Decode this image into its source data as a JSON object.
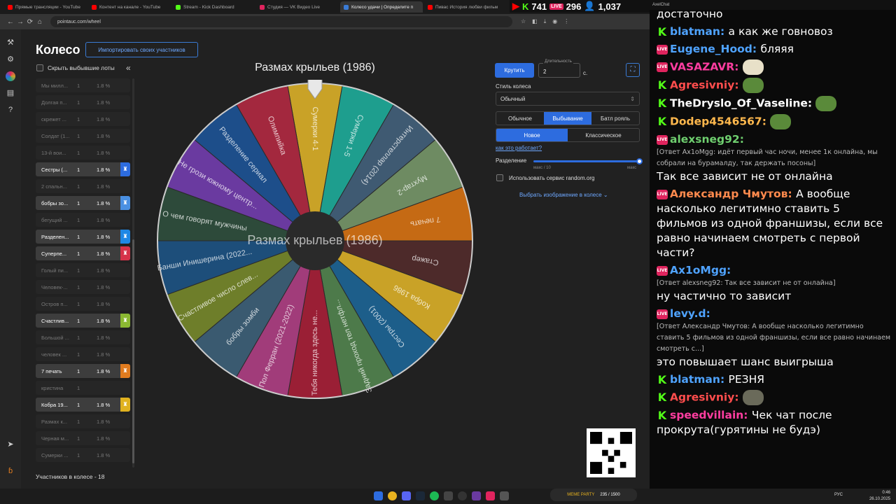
{
  "browser": {
    "tabs": [
      {
        "label": "Прямые трансляции - YouTube",
        "color": "#ff0000"
      },
      {
        "label": "Контент на канале - YouTube",
        "color": "#ff0000"
      },
      {
        "label": "Stream - Kick Dashboard",
        "color": "#53fc18"
      },
      {
        "label": "Студия — VK Видео Live",
        "color": "#e0245e"
      },
      {
        "label": "Колесо удачи | Определите п",
        "color": "#3a7bd5"
      },
      {
        "label": "Пивас История любви фильм",
        "color": "#ff0000"
      }
    ],
    "url": "pointauc.com/wheel"
  },
  "ticker": {
    "kick": "741",
    "vk": "296",
    "viewers": "1,037"
  },
  "page": {
    "title": "Колесо",
    "import_label": "Импортировать своих участников",
    "hide_label": "Скрыть выбывшие лоты",
    "count_label": "Участников в колесе - 18",
    "wheel_title": "Размах крыльев (1986)",
    "center_label": "Размах крыльев (1986)"
  },
  "lots": [
    {
      "name": "Мы милл...",
      "qty": "1",
      "pct": "1.8 %",
      "active": false
    },
    {
      "name": "Долгая п...",
      "qty": "1",
      "pct": "1.8 %",
      "active": false
    },
    {
      "name": "скрежет ...",
      "qty": "1",
      "pct": "1.8 %",
      "active": false
    },
    {
      "name": "Солдат (1...",
      "qty": "1",
      "pct": "1.8 %",
      "active": false
    },
    {
      "name": "13-й вои...",
      "qty": "1",
      "pct": "1.8 %",
      "active": false
    },
    {
      "name": "Сестры (...",
      "qty": "1",
      "pct": "1.8 %",
      "active": true,
      "color": "#2d6cdf"
    },
    {
      "name": "2 спальн...",
      "qty": "1",
      "pct": "1.8 %",
      "active": false
    },
    {
      "name": "бобры зо...",
      "qty": "1",
      "pct": "1.8 %",
      "active": true,
      "color": "#4a90e2"
    },
    {
      "name": "бегущий ...",
      "qty": "1",
      "pct": "1.8 %",
      "active": false
    },
    {
      "name": "Разделен...",
      "qty": "1",
      "pct": "1.8 %",
      "active": true,
      "color": "#1e88e5"
    },
    {
      "name": "Суперпе...",
      "qty": "1",
      "pct": "1.8 %",
      "active": true,
      "color": "#d6334a"
    },
    {
      "name": "Голый пи...",
      "qty": "1",
      "pct": "1.8 %",
      "active": false
    },
    {
      "name": "Человек-...",
      "qty": "1",
      "pct": "1.8 %",
      "active": false
    },
    {
      "name": "Остров п...",
      "qty": "1",
      "pct": "1.8 %",
      "active": false
    },
    {
      "name": "Счастлив...",
      "qty": "1",
      "pct": "1.8 %",
      "active": true,
      "color": "#8bb832"
    },
    {
      "name": "Большой ...",
      "qty": "1",
      "pct": "1.8 %",
      "active": false
    },
    {
      "name": "человек ...",
      "qty": "1",
      "pct": "1.8 %",
      "active": false
    },
    {
      "name": "7 печать",
      "qty": "1",
      "pct": "1.8 %",
      "active": true,
      "color": "#e07b1f"
    },
    {
      "name": "кристина",
      "qty": "1",
      "pct": "",
      "active": false
    },
    {
      "name": "Кобра 19...",
      "qty": "1",
      "pct": "1.8 %",
      "active": true,
      "color": "#e0b21f"
    },
    {
      "name": "Размах к...",
      "qty": "1",
      "pct": "1.8 %",
      "active": false
    },
    {
      "name": "Черная м...",
      "qty": "1",
      "pct": "1.8 %",
      "active": false
    },
    {
      "name": "Сумерки ...",
      "qty": "1",
      "pct": "1.8 %",
      "active": false
    }
  ],
  "wheel_segments": [
    {
      "label": "Сумерки 4-1",
      "color": "#c9a227"
    },
    {
      "label": "Сумерки 1-5",
      "color": "#1e9e8e"
    },
    {
      "label": "Интерстеллар (2014)",
      "color": "#3f5a72"
    },
    {
      "label": "Мухтар-2",
      "color": "#6e8b62"
    },
    {
      "label": "7 печать",
      "color": "#c56a14"
    },
    {
      "label": "Стажер",
      "color": "#4d2a2a"
    },
    {
      "label": "Кобра 1986",
      "color": "#c9a227"
    },
    {
      "label": "Сестры (2001)",
      "color": "#1d5e8a"
    },
    {
      "label": "Задний проход тел нетфл...",
      "color": "#4d7a4a"
    },
    {
      "label": "Тебя никогда здесь не...",
      "color": "#9a1f35"
    },
    {
      "label": "Пол Ферран (2021-2022)",
      "color": "#a13c7a"
    },
    {
      "label": "бобры зомби",
      "color": "#3a5a70"
    },
    {
      "label": "Счастливое число слев...",
      "color": "#6e7e2a"
    },
    {
      "label": "Банши Инишерина (2022...",
      "color": "#1d4e7a"
    },
    {
      "label": "О чем говорят мужчины",
      "color": "#2d4a3a"
    },
    {
      "label": "Не грози южному центр...",
      "color": "#6a3aa0"
    },
    {
      "label": "Разделение сериал",
      "color": "#1d4e8a"
    },
    {
      "label": "Олимпийка",
      "color": "#a3283e"
    }
  ],
  "controls": {
    "spin_label": "Крутить",
    "duration_label": "Длительность",
    "duration_value": "2",
    "sec_label": "с.",
    "style_label": "Стиль колеса",
    "style_value": "Обычный",
    "modes": [
      "Обычное",
      "Выбывание",
      "Батл рояль"
    ],
    "variants": [
      "Новое",
      "Классическое"
    ],
    "how_label": "как это работает?",
    "split_label": "Разделение",
    "split_min": "макс / 10",
    "split_max": "макс",
    "split_value": 1.0,
    "random_label": "Использовать сервис random.org",
    "pick_label": "Выбрать изображение в колесе"
  },
  "chat": {
    "app": "AxelChat",
    "messages": [
      {
        "platform": "",
        "user": "",
        "color": "#fff",
        "text": "достаточно"
      },
      {
        "platform": "kick",
        "user": "blatman",
        "color": "#4fa3ff",
        "text": "а как же говновоз"
      },
      {
        "platform": "live",
        "user": "Eugene_Hood",
        "color": "#4fa3ff",
        "text": "бляяя"
      },
      {
        "platform": "live",
        "user": "VASAZAVR",
        "color": "#ff3da0",
        "text": "",
        "emote": "#e8e0c8"
      },
      {
        "platform": "kick",
        "user": "Agresivniy",
        "color": "#ff4d4d",
        "text": "",
        "emote": "#5a8a3a"
      },
      {
        "platform": "kick",
        "user": "TheDryslo_Of_Vaseline",
        "color": "#fff",
        "text": "",
        "emote": "#5a8a3a"
      },
      {
        "platform": "kick",
        "user": "Dodep4546567",
        "color": "#ffb84d",
        "text": "",
        "emote": "#5a8a3a"
      },
      {
        "platform": "live",
        "user": "alexsneg92",
        "color": "#6fcf6f",
        "text": "",
        "reply": "[Ответ Ax1oMgg: идёт первый час ночи, менее 1к онлайна, мы собрали на бурамалду, так держать посоны]",
        "after": "Так все зависит не от онлайна"
      },
      {
        "platform": "live",
        "user": "Александр Чмутов",
        "color": "#ff8a4d",
        "text": "А вообще насколько легитимно ставить 5 фильмов из одной франшизы, если все равно начинаем смотреть с первой части?"
      },
      {
        "platform": "live",
        "user": "Ax1oMgg",
        "color": "#4fa3ff",
        "text": "",
        "reply": "[Ответ alexsneg92: Так все зависит не от онлайна]",
        "after": "ну частично то зависит"
      },
      {
        "platform": "live",
        "user": "levy.d",
        "color": "#4fa3ff",
        "text": "",
        "reply": "[Ответ Александр Чмутов: А вообще насколько легитимно ставить 5 фильмов из одной франшизы, если все равно начинаем смотреть с...]",
        "after": "это повышает шанс выигрыша"
      },
      {
        "platform": "kick",
        "user": "blatman",
        "color": "#4fa3ff",
        "text": "РЕЗНЯ"
      },
      {
        "platform": "kick",
        "user": "Agresivniy",
        "color": "#ff4d4d",
        "text": "",
        "emote": "#6a6a5a"
      },
      {
        "platform": "kick",
        "user": "speedvillain",
        "color": "#ff3da0",
        "text": "Чек чат после прокрута(гурятины не будэ)"
      }
    ]
  },
  "taskbar": {
    "lang": "РУС",
    "time": "0:46",
    "date": "26.10.2025",
    "meme_label": "MEME PARTY",
    "meme_value": "235 / 1500"
  }
}
